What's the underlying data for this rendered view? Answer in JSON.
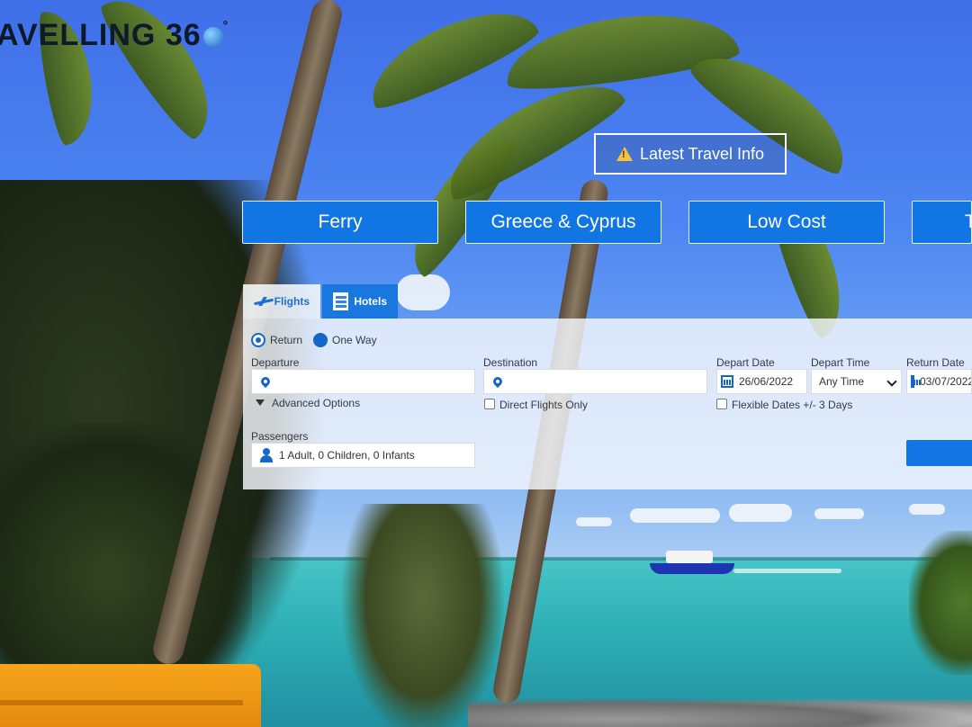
{
  "brand": {
    "logo_text": "AVELLING 36",
    "logo_suffix": "°"
  },
  "header": {
    "travel_info_label": "Latest Travel Info"
  },
  "categories": [
    {
      "label": "Ferry"
    },
    {
      "label": "Greece & Cyprus"
    },
    {
      "label": "Low Cost"
    },
    {
      "label": "T"
    }
  ],
  "tabs": [
    {
      "label": "Flights",
      "icon": "plane-icon",
      "active": true
    },
    {
      "label": "Hotels",
      "icon": "hotel-icon",
      "active": false
    }
  ],
  "search_form": {
    "trip_type": {
      "options": [
        "Return",
        "One Way"
      ],
      "selected": "Return"
    },
    "departure": {
      "label": "Departure",
      "value": ""
    },
    "destination": {
      "label": "Destination",
      "value": ""
    },
    "advanced_options_label": "Advanced Options",
    "direct_flights_label": "Direct Flights Only",
    "depart_date": {
      "label": "Depart Date",
      "value": "26/06/2022"
    },
    "depart_time": {
      "label": "Depart Time",
      "value": "Any Time"
    },
    "return_date": {
      "label": "Return Date",
      "value": "03/07/2022"
    },
    "flexible_dates_label": "Flexible Dates +/- 3 Days",
    "passengers": {
      "label": "Passengers",
      "value": "1 Adult, 0 Children, 0 Infants"
    }
  },
  "colors": {
    "brand_blue": "#1176e3",
    "accent_blue": "#1467c8",
    "warning_yellow": "#f7c33c"
  }
}
